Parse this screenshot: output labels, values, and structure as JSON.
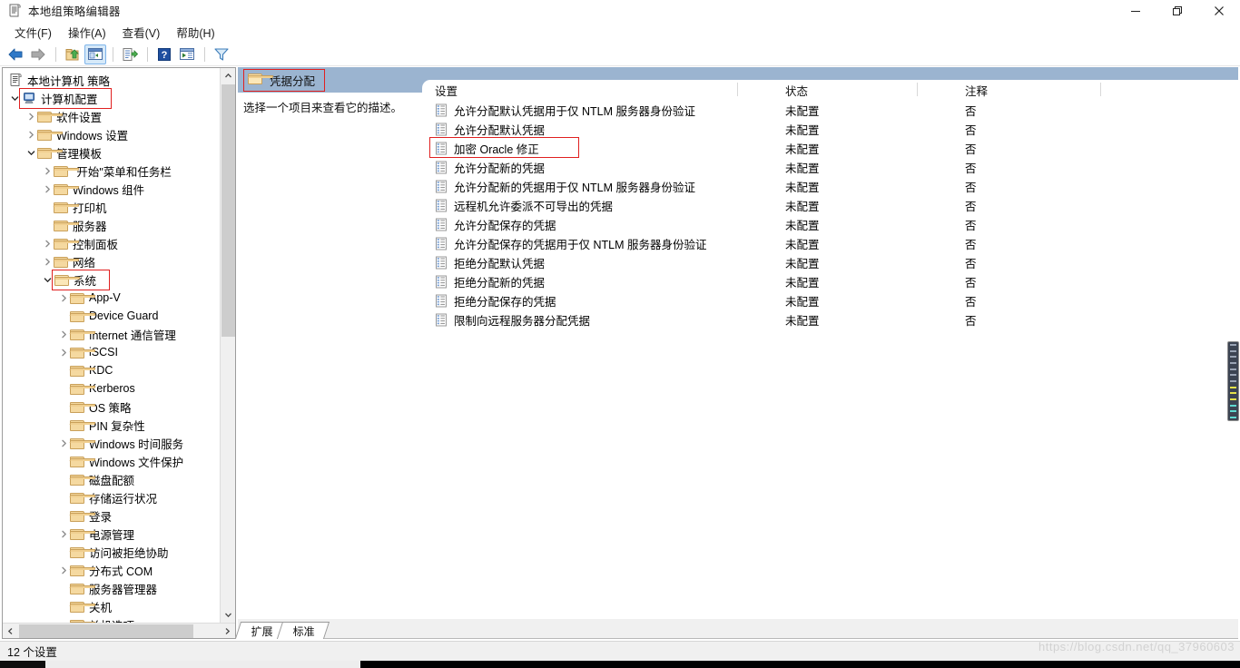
{
  "window": {
    "title": "本地组策略编辑器",
    "icon": "policy-document-icon",
    "minimize_label": "最小化",
    "maximize_label": "向下还原",
    "close_label": "关闭"
  },
  "menubar": {
    "items": [
      {
        "label": "文件(F)",
        "name": "menu-file"
      },
      {
        "label": "操作(A)",
        "name": "menu-action"
      },
      {
        "label": "查看(V)",
        "name": "menu-view"
      },
      {
        "label": "帮助(H)",
        "name": "menu-help"
      }
    ]
  },
  "toolbar": {
    "buttons": [
      {
        "name": "back-icon",
        "title": "后退"
      },
      {
        "name": "forward-icon",
        "title": "前进"
      },
      {
        "name": "up-folder-icon",
        "title": "上移一级"
      },
      {
        "name": "show-hide-tree-icon",
        "title": "显示/隐藏控制台树",
        "pressed": true
      },
      {
        "name": "export-list-icon",
        "title": "导出列表"
      },
      {
        "name": "help-icon",
        "title": "帮助"
      },
      {
        "name": "properties-icon",
        "title": "属性"
      },
      {
        "name": "filter-icon",
        "title": "筛选器"
      }
    ]
  },
  "tree": {
    "root_label": "本地计算机 策略",
    "root_icon": "policy-document-icon",
    "items": [
      {
        "label": "计算机配置",
        "indent": 0,
        "icon": "computer-icon",
        "expander": "down",
        "highlight": true
      },
      {
        "label": "软件设置",
        "indent": 1,
        "icon": "folder-icon",
        "expander": "right"
      },
      {
        "label": "Windows 设置",
        "indent": 1,
        "icon": "folder-icon",
        "expander": "right"
      },
      {
        "label": "管理模板",
        "indent": 1,
        "icon": "folder-icon",
        "expander": "down"
      },
      {
        "label": "\"开始\"菜单和任务栏",
        "indent": 2,
        "icon": "folder-icon",
        "expander": "right"
      },
      {
        "label": "Windows 组件",
        "indent": 2,
        "icon": "folder-icon",
        "expander": "right"
      },
      {
        "label": "打印机",
        "indent": 2,
        "icon": "folder-icon",
        "expander": "none"
      },
      {
        "label": "服务器",
        "indent": 2,
        "icon": "folder-icon",
        "expander": "none"
      },
      {
        "label": "控制面板",
        "indent": 2,
        "icon": "folder-icon",
        "expander": "right"
      },
      {
        "label": "网络",
        "indent": 2,
        "icon": "folder-icon",
        "expander": "right"
      },
      {
        "label": "系统",
        "indent": 2,
        "icon": "folder-open-icon",
        "expander": "down",
        "highlight": true
      },
      {
        "label": "App-V",
        "indent": 3,
        "icon": "folder-icon",
        "expander": "right"
      },
      {
        "label": "Device Guard",
        "indent": 3,
        "icon": "folder-icon",
        "expander": "none"
      },
      {
        "label": "Internet 通信管理",
        "indent": 3,
        "icon": "folder-icon",
        "expander": "right"
      },
      {
        "label": "iSCSI",
        "indent": 3,
        "icon": "folder-icon",
        "expander": "right"
      },
      {
        "label": "KDC",
        "indent": 3,
        "icon": "folder-icon",
        "expander": "none"
      },
      {
        "label": "Kerberos",
        "indent": 3,
        "icon": "folder-icon",
        "expander": "none"
      },
      {
        "label": "OS 策略",
        "indent": 3,
        "icon": "folder-icon",
        "expander": "none"
      },
      {
        "label": "PIN 复杂性",
        "indent": 3,
        "icon": "folder-icon",
        "expander": "none"
      },
      {
        "label": "Windows 时间服务",
        "indent": 3,
        "icon": "folder-icon",
        "expander": "right"
      },
      {
        "label": "Windows 文件保护",
        "indent": 3,
        "icon": "folder-icon",
        "expander": "none"
      },
      {
        "label": "磁盘配额",
        "indent": 3,
        "icon": "folder-icon",
        "expander": "none"
      },
      {
        "label": "存储运行状况",
        "indent": 3,
        "icon": "folder-icon",
        "expander": "none"
      },
      {
        "label": "登录",
        "indent": 3,
        "icon": "folder-icon",
        "expander": "none"
      },
      {
        "label": "电源管理",
        "indent": 3,
        "icon": "folder-icon",
        "expander": "right"
      },
      {
        "label": "访问被拒绝协助",
        "indent": 3,
        "icon": "folder-icon",
        "expander": "none"
      },
      {
        "label": "分布式 COM",
        "indent": 3,
        "icon": "folder-icon",
        "expander": "right"
      },
      {
        "label": "服务器管理器",
        "indent": 3,
        "icon": "folder-icon",
        "expander": "none"
      },
      {
        "label": "关机",
        "indent": 3,
        "icon": "folder-icon",
        "expander": "none"
      },
      {
        "label": "关机选项",
        "indent": 3,
        "icon": "folder-icon",
        "expander": "none"
      }
    ]
  },
  "right_pane": {
    "header_title": "凭据分配",
    "header_icon": "folder-icon",
    "description": "选择一个项目来查看它的描述。",
    "columns": [
      {
        "key": "setting",
        "label": "设置"
      },
      {
        "key": "status",
        "label": "状态"
      },
      {
        "key": "comment",
        "label": "注释"
      }
    ],
    "rows": [
      {
        "setting": "允许分配默认凭据用于仅 NTLM 服务器身份验证",
        "status": "未配置",
        "comment": "否"
      },
      {
        "setting": "允许分配默认凭据",
        "status": "未配置",
        "comment": "否"
      },
      {
        "setting": "加密 Oracle 修正",
        "status": "未配置",
        "comment": "否",
        "highlight": true
      },
      {
        "setting": "允许分配新的凭据",
        "status": "未配置",
        "comment": "否"
      },
      {
        "setting": "允许分配新的凭据用于仅 NTLM 服务器身份验证",
        "status": "未配置",
        "comment": "否"
      },
      {
        "setting": "远程机允许委派不可导出的凭据",
        "status": "未配置",
        "comment": "否"
      },
      {
        "setting": "允许分配保存的凭据",
        "status": "未配置",
        "comment": "否"
      },
      {
        "setting": "允许分配保存的凭据用于仅 NTLM 服务器身份验证",
        "status": "未配置",
        "comment": "否"
      },
      {
        "setting": "拒绝分配默认凭据",
        "status": "未配置",
        "comment": "否"
      },
      {
        "setting": "拒绝分配新的凭据",
        "status": "未配置",
        "comment": "否"
      },
      {
        "setting": "拒绝分配保存的凭据",
        "status": "未配置",
        "comment": "否"
      },
      {
        "setting": "限制向远程服务器分配凭据",
        "status": "未配置",
        "comment": "否"
      }
    ]
  },
  "bottom_tabs": [
    {
      "label": "扩展",
      "name": "tab-extended"
    },
    {
      "label": "标准",
      "name": "tab-standard",
      "selected": true
    }
  ],
  "statusbar": {
    "text": "12 个设置"
  },
  "watermark": {
    "text": "https://blog.csdn.net/qq_37960603"
  },
  "colors": {
    "header_band": "#9bb4d0",
    "highlight_box": "#e02020",
    "folder": "#f5d9a0",
    "window_bg": "#ffffff",
    "chrome_bg": "#f0f0f0"
  }
}
